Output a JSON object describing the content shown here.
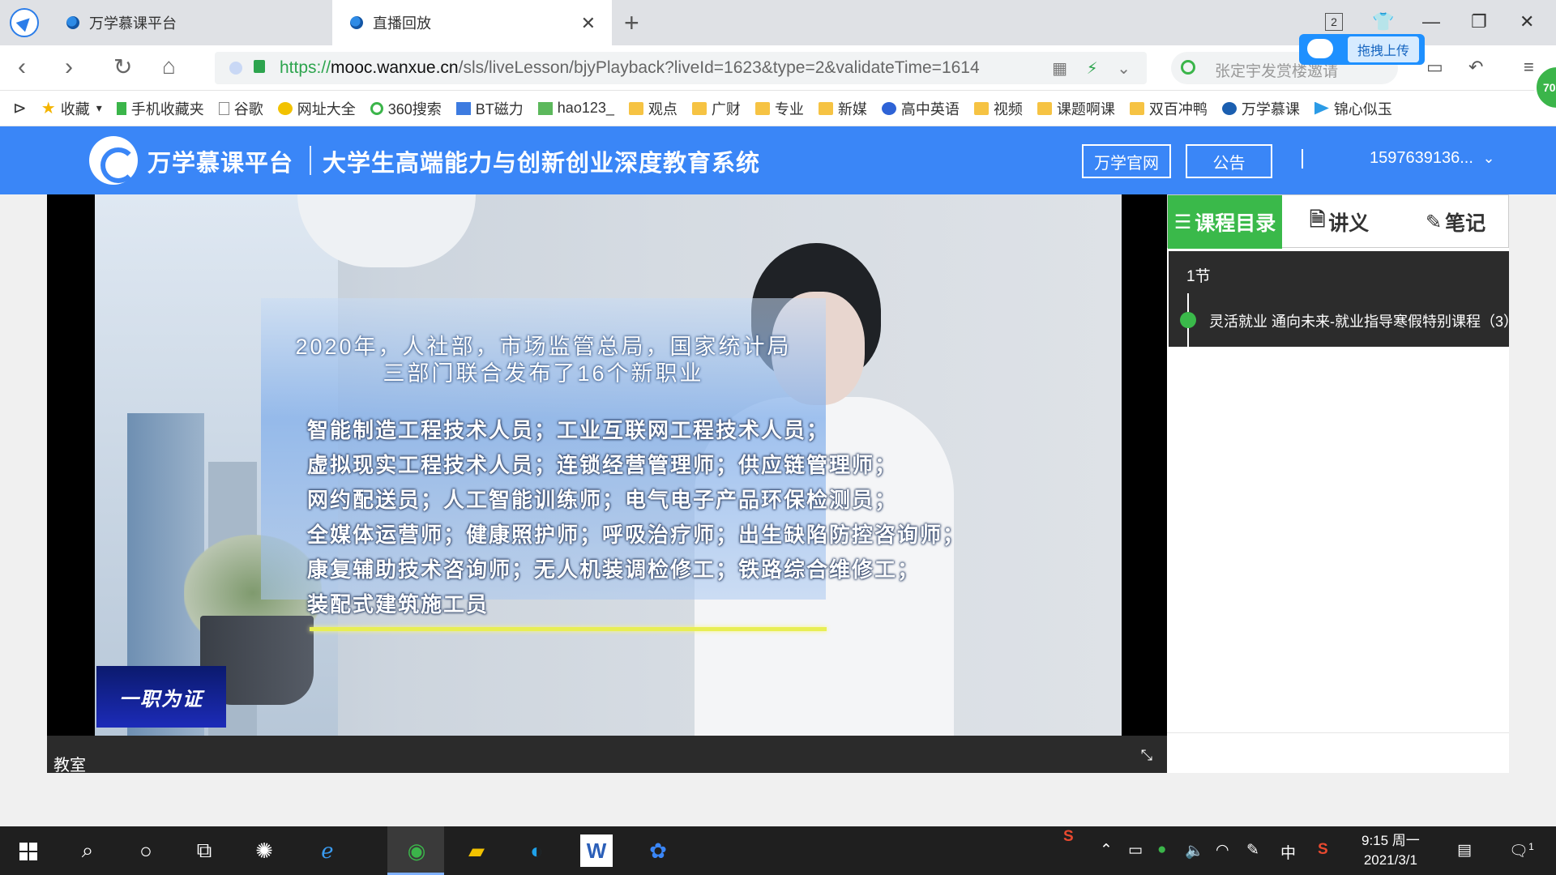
{
  "browser": {
    "tabs": [
      {
        "title": "万学慕课平台"
      },
      {
        "title": "直播回放"
      }
    ],
    "new_tab": "+",
    "window_badge": "2",
    "url_scheme": "https://",
    "url_host": "mooc.wanxue.cn",
    "url_path": "/sls/liveLesson/bjyPlayback?liveId=1623&type=2&validateTime=1614",
    "search_placeholder": "张定宇发赏楼邀请",
    "upload_label": "拖拽上传",
    "badge_number": "70"
  },
  "bookmarks": [
    {
      "label": "收藏",
      "icon": "star-icon"
    },
    {
      "label": "手机收藏夹",
      "icon": "phone-icon"
    },
    {
      "label": "谷歌",
      "icon": "page-icon"
    },
    {
      "label": "网址大全",
      "icon": "plus-circle-icon"
    },
    {
      "label": "360搜索",
      "icon": "search-360-icon"
    },
    {
      "label": "BT磁力",
      "icon": "bt-icon"
    },
    {
      "label": "hao123_",
      "icon": "hao-icon"
    },
    {
      "label": "观点",
      "icon": "folder-icon"
    },
    {
      "label": "广财",
      "icon": "folder-icon"
    },
    {
      "label": "专业",
      "icon": "folder-icon"
    },
    {
      "label": "新媒",
      "icon": "folder-icon"
    },
    {
      "label": "高中英语",
      "icon": "paw-icon"
    },
    {
      "label": "视频",
      "icon": "folder-icon"
    },
    {
      "label": "课题啊课",
      "icon": "folder-icon"
    },
    {
      "label": "双百冲鸭",
      "icon": "folder-icon"
    },
    {
      "label": "万学慕课",
      "icon": "site-icon"
    },
    {
      "label": "锦心似玉",
      "icon": "play-icon"
    }
  ],
  "site": {
    "name": "万学慕课平台",
    "subtitle": "大学生高端能力与创新创业深度教育系统",
    "official_site": "万学官网",
    "notice": "公告",
    "user": "1597639136..."
  },
  "video": {
    "title_line1": "2020年，人社部，市场监管总局，国家统计局",
    "title_line2": "三部门联合发布了16个新职业",
    "lines": [
      "智能制造工程技术人员；工业互联网工程技术人员；",
      "虚拟现实工程技术人员；连锁经营管理师；供应链管理师；",
      "网约配送员；人工智能训练师；电气电子产品环保检测员；",
      "全媒体运营师；健康照护师；呼吸治疗师；出生缺陷防控咨询师；",
      "康复辅助技术咨询师；无人机装调检修工；铁路综合维修工；",
      "装配式建筑施工员"
    ],
    "logo_text": "一职为证",
    "classroom_label": "教室"
  },
  "side_panel": {
    "tabs": [
      {
        "label": "课程目录",
        "glyph": "☰"
      },
      {
        "label": "讲义",
        "glyph": "🗎"
      },
      {
        "label": "笔记",
        "glyph": "✎"
      }
    ],
    "section": "1节",
    "lesson": "灵活就业 通向未来-就业指导寒假特别课程（3）"
  },
  "taskbar": {
    "input_method": "中",
    "time": "9:15 周一",
    "date": "2021/3/1",
    "notification_count": "1"
  },
  "colors": {
    "header_blue": "#3a86f7",
    "active_green": "#3ab94a",
    "catalog_dark": "#2c2c2c"
  }
}
